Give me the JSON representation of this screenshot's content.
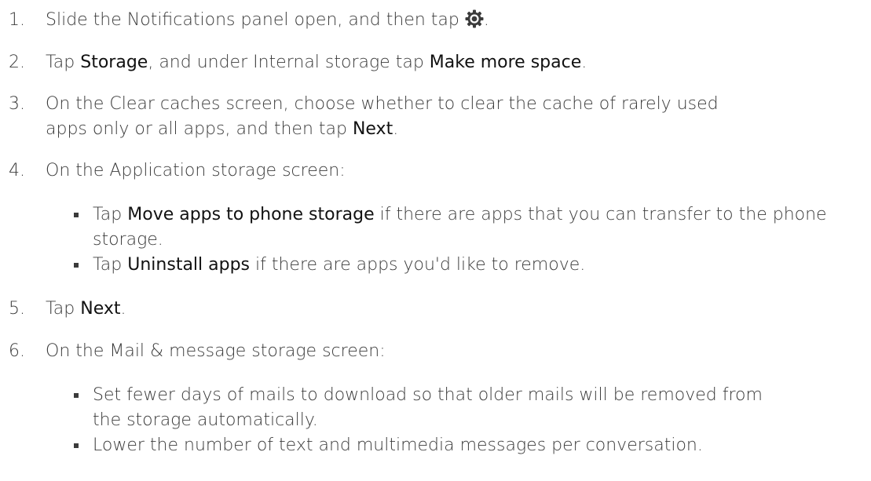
{
  "steps": [
    {
      "number": "1.",
      "parts": [
        {
          "t": "Slide the Notifications panel open, and then tap "
        },
        {
          "icon": "gear-icon"
        },
        {
          "t": "."
        }
      ]
    },
    {
      "number": "2.",
      "parts": [
        {
          "t": "Tap "
        },
        {
          "b": "Storage"
        },
        {
          "t": ", and under Internal storage tap "
        },
        {
          "b": "Make more space"
        },
        {
          "t": "."
        }
      ]
    },
    {
      "number": "3.",
      "parts": [
        {
          "t": "On the Clear caches screen, choose whether to clear the cache of rarely used apps only or all apps, and then tap "
        },
        {
          "b": "Next"
        },
        {
          "t": "."
        }
      ]
    },
    {
      "number": "4.",
      "parts": [
        {
          "t": "On the Application storage screen:"
        }
      ],
      "bullets": [
        [
          {
            "t": "Tap "
          },
          {
            "b": "Move apps to phone storage"
          },
          {
            "t": " if there are apps that you can transfer to the phone storage."
          }
        ],
        [
          {
            "t": "Tap "
          },
          {
            "b": "Uninstall apps"
          },
          {
            "t": " if there are apps you'd like to remove."
          }
        ]
      ]
    },
    {
      "number": "5.",
      "parts": [
        {
          "t": "Tap "
        },
        {
          "b": "Next"
        },
        {
          "t": "."
        }
      ]
    },
    {
      "number": "6.",
      "parts": [
        {
          "t": "On the Mail & message storage screen:"
        }
      ],
      "bullets": [
        [
          {
            "t": "Set fewer days of mails to download so that older mails will be removed from the storage automatically."
          }
        ],
        [
          {
            "t": "Lower the number of text and multimedia messages per conversation."
          }
        ]
      ]
    }
  ]
}
